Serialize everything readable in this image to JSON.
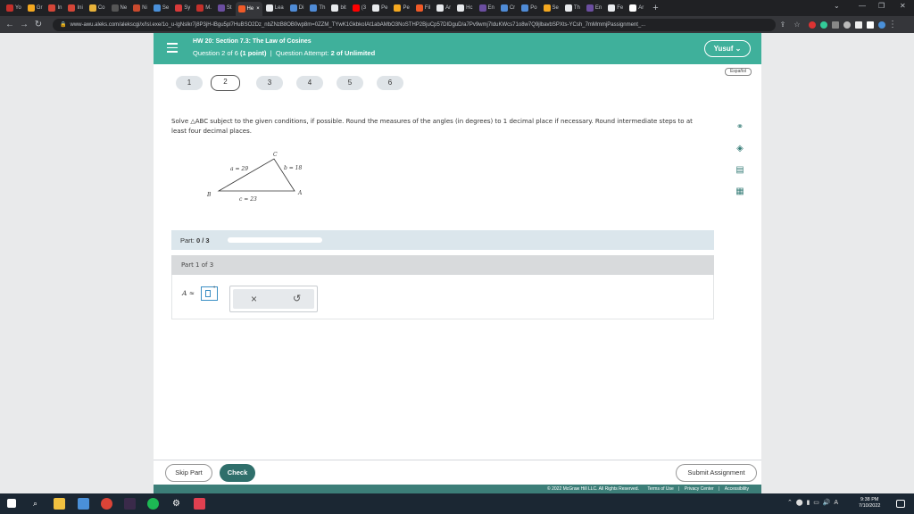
{
  "browser": {
    "tabs": [
      {
        "label": "Yo",
        "color": "#c4302b"
      },
      {
        "label": "Gr",
        "color": "#f4a820"
      },
      {
        "label": "In",
        "color": "#d44638"
      },
      {
        "label": "Ini",
        "color": "#d44638"
      },
      {
        "label": "Co",
        "color": "#e8b23a"
      },
      {
        "label": "Ne",
        "color": "#555555"
      },
      {
        "label": "Ni",
        "color": "#c94a2e"
      },
      {
        "label": "Se",
        "color": "#4a90d9"
      },
      {
        "label": "Sy",
        "color": "#d83a3a"
      },
      {
        "label": "M.",
        "color": "#c4302b"
      },
      {
        "label": "St",
        "color": "#6b4ea0"
      },
      {
        "label": "He",
        "color": "#f05a28"
      },
      {
        "label": "Lea",
        "color": "#e8eaed"
      },
      {
        "label": "Di",
        "color": "#4f8bd6"
      },
      {
        "label": "Th",
        "color": "#4f8bd6"
      },
      {
        "label": "bit",
        "color": "#e8eaed"
      },
      {
        "label": "(3",
        "color": "#ff0000"
      },
      {
        "label": "Pe",
        "color": "#e8eaed"
      },
      {
        "label": "Pe",
        "color": "#f4a820"
      },
      {
        "label": "Fil",
        "color": "#f05a28"
      },
      {
        "label": "Ar",
        "color": "#e8eaed"
      },
      {
        "label": "Hc",
        "color": "#e8eaed"
      },
      {
        "label": "En",
        "color": "#6b4ea0"
      },
      {
        "label": "Cr",
        "color": "#4f8bd6"
      },
      {
        "label": "Po",
        "color": "#4f8bd6"
      },
      {
        "label": "Se",
        "color": "#f4a820"
      },
      {
        "label": "Th",
        "color": "#e8eaed"
      },
      {
        "label": "En",
        "color": "#6b4ea0"
      },
      {
        "label": "Fe",
        "color": "#e8eaed"
      },
      {
        "label": "Ar",
        "color": "#ffffff"
      }
    ],
    "active_tab_index": 11,
    "new_tab": "+",
    "url": "www-awu.aleks.com/alekscgi/x/Isl.exe/1o_u-lgNslkr7j8P3jH-lBgu5pl7HuBSO2Dz_nbZNzB8OB0wp8m=0ZZM_TYwK1GkbkoIAt1abAMbO3NoSTHP2BjuCp57DIDguD/a7Pv9wmj7IduKWcs71o8w7Q9jlbavbSPXts-YCsh_7mMmmjPassignment_..."
  },
  "header": {
    "title": "HW 20: Section 7.3: The Law of Cosines",
    "question_prefix": "Question 2 of 6",
    "points": "(1 point)",
    "separator": "|",
    "attempt_prefix": "Question Attempt:",
    "attempt_value": "2 of Unlimited",
    "user": "Yusuf",
    "language": "Español"
  },
  "questions": [
    "1",
    "2",
    "3",
    "4",
    "5",
    "6"
  ],
  "current_question": 2,
  "problem": {
    "text": "Solve △ABC subject to the given conditions, if possible. Round the measures of the angles (in degrees) to 1 decimal place if necessary. Round intermediate steps to at least four decimal places.",
    "label_a": "a = 29",
    "label_b": "b = 18",
    "label_c": "c = 23",
    "vertex_A": "A",
    "vertex_B": "B",
    "vertex_C": "C"
  },
  "part": {
    "label": "Part:",
    "progress": "0 / 3",
    "progress_fraction": 0,
    "part_of": "Part 1 of 3"
  },
  "answer": {
    "label": "A ≈",
    "degree": "°",
    "value": ""
  },
  "popover": {
    "clear": "×",
    "undo": "↺"
  },
  "footer": {
    "skip": "Skip Part",
    "check": "Check",
    "submit": "Submit Assignment",
    "copyright": "© 2022 McGraw Hill LLC. All Rights Reserved.",
    "terms": "Terms of Use",
    "privacy": "Privacy Center",
    "accessibility": "Accessibility",
    "link_sep": "|"
  },
  "taskbar": {
    "time": "9:38 PM",
    "date": "7/10/2022"
  },
  "colors": {
    "header_teal": "#3fb09b",
    "check_button": "#2f6f6b",
    "legal_bar": "#3c7e78"
  }
}
